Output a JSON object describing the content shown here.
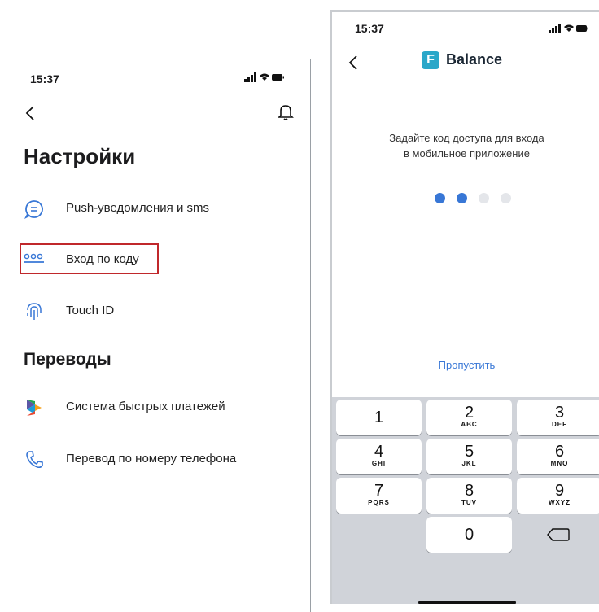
{
  "left": {
    "status_time": "15:37",
    "title": "Настройки",
    "menu_items": [
      {
        "label": "Push-уведомления и sms",
        "icon": "chat-icon"
      },
      {
        "label": "Вход по коду",
        "icon": "passcode-icon"
      },
      {
        "label": "Touch ID",
        "icon": "fingerprint-icon"
      }
    ],
    "transfers_title": "Переводы",
    "transfer_items": [
      {
        "label": "Система быстрых платежей",
        "icon": "sbp-icon"
      },
      {
        "label": "Перевод по номеру телефона",
        "icon": "phone-icon"
      }
    ],
    "accent_color": "#3877d6",
    "highlight_color": "#c0282b"
  },
  "right": {
    "status_time": "15:37",
    "brand_name": "Balance",
    "brand_letter": "F",
    "prompt_line1": "Задайте код доступа для входа",
    "prompt_line2": "в мобильное приложение",
    "dots_filled": 2,
    "dots_total": 4,
    "skip_label": "Пропустить",
    "keys": [
      {
        "num": "1",
        "letters": ""
      },
      {
        "num": "2",
        "letters": "ABC"
      },
      {
        "num": "3",
        "letters": "DEF"
      },
      {
        "num": "4",
        "letters": "GHI"
      },
      {
        "num": "5",
        "letters": "JKL"
      },
      {
        "num": "6",
        "letters": "MNO"
      },
      {
        "num": "7",
        "letters": "PQRS"
      },
      {
        "num": "8",
        "letters": "TUV"
      },
      {
        "num": "9",
        "letters": "WXYZ"
      },
      {
        "num": "0",
        "letters": ""
      }
    ],
    "brand_color": "#2aa7c9"
  }
}
